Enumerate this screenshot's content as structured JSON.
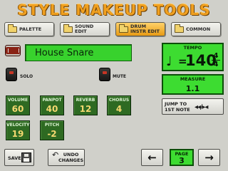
{
  "title": "STYLE MAKEUP TOOLS",
  "tabs": [
    {
      "label": "PALETTE",
      "active": false
    },
    {
      "label": "SOUND\nEDIT",
      "active": false
    },
    {
      "label": "DRUM\nINSTR EDIT",
      "active": true
    },
    {
      "label": "COMMON",
      "active": false
    }
  ],
  "instrument": {
    "icon": "snare-drum-icon",
    "name": "House Snare"
  },
  "solo_label": "SOLO",
  "mute_label": "MUTE",
  "tempo": {
    "label": "TEMPO",
    "note_symbol": "♩",
    "equals": "=",
    "value": "140",
    "time_sig_top": "4",
    "time_sig_bottom": "4"
  },
  "measure": {
    "label": "MEASURE",
    "value": "1.1"
  },
  "jump": {
    "label": "JUMP TO\n1ST NOTE",
    "icon": "◂◂/▸◂"
  },
  "params": [
    {
      "label": "VOLUME",
      "value": "60"
    },
    {
      "label": "PANPOT",
      "value": "40"
    },
    {
      "label": "REVERB",
      "value": "12"
    },
    {
      "label": "CHORUS",
      "value": "4"
    },
    {
      "label": "VELOCITY",
      "value": "19"
    },
    {
      "label": "PITCH",
      "value": "-2"
    }
  ],
  "save_label": "SAVE",
  "undo_label": "UNDO\nCHANGES",
  "page": {
    "label": "PAGE",
    "value": "3"
  },
  "colors": {
    "accent": "#f0a020",
    "display_green": "#3ddc31",
    "param_green": "#2e6a22"
  }
}
